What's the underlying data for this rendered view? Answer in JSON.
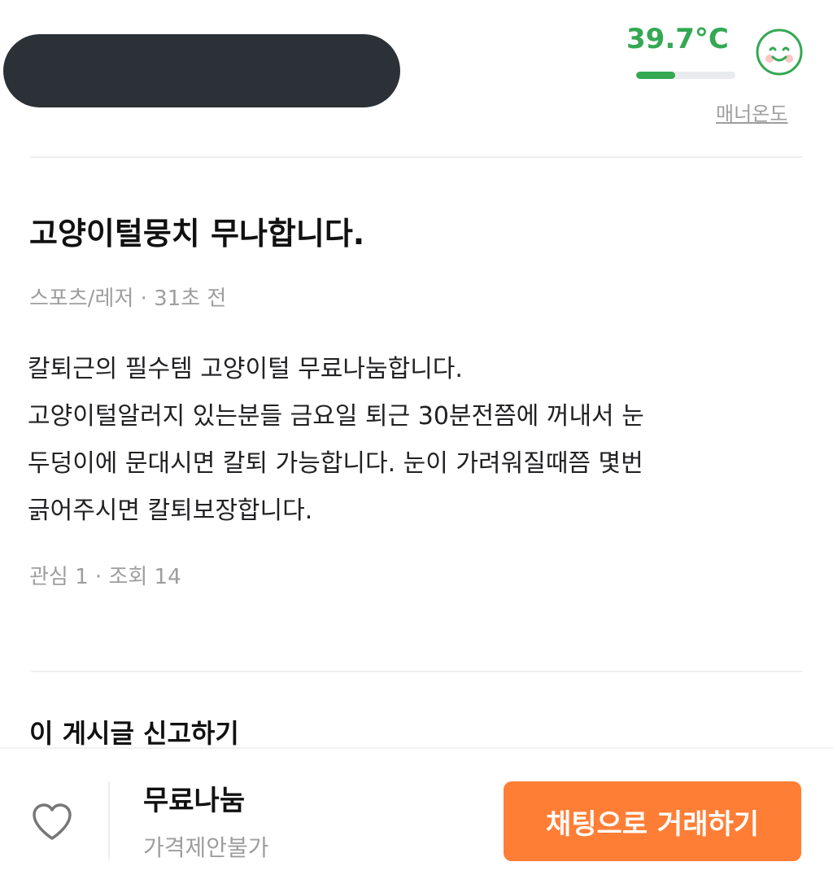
{
  "seller": {
    "manner_temperature": "39.7°C",
    "manner_level_percent": 39.7,
    "manner_label": "매너온도",
    "manner_color": "#34a853",
    "manner_icon": "smile-face-icon"
  },
  "post": {
    "title": "고양이털뭉치 무나합니다.",
    "category": "스포츠/레저",
    "time_ago": "31초 전",
    "meta": "스포츠/레저 · 31초 전",
    "body_lines": [
      "칼퇴근의 필수템 고양이털 무료나눔합니다.",
      "고양이털알러지 있는분들 금요일 퇴근 30분전쯤에 꺼내서 눈",
      "두덩이에 문대시면 칼퇴 가능합니다. 눈이 가려워질때쯤 몇번",
      "긁어주시면 칼퇴보장합니다."
    ],
    "stats": "관심 1 · 조회 14"
  },
  "report": {
    "label": "이 게시글 신고하기"
  },
  "bottom_bar": {
    "heart_icon": "heart-outline-icon",
    "price": "무료나눔",
    "price_note": "가격제안불가",
    "chat_button": "채팅으로 거래하기",
    "chat_button_color": "#ff7e36"
  }
}
